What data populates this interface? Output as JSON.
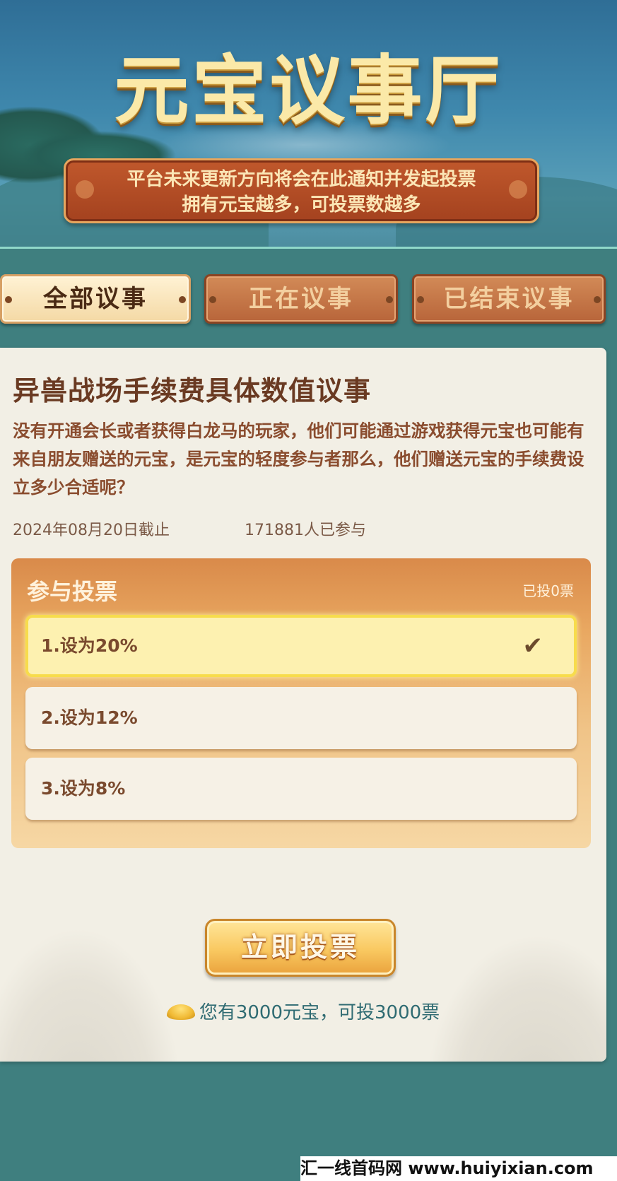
{
  "header": {
    "title": "元宝议事厅",
    "banner_line1": "平台未来更新方向将会在此通知并发起投票",
    "banner_line2": "拥有元宝越多，可投票数越多"
  },
  "tabs": [
    {
      "label": "全部议事",
      "active": true
    },
    {
      "label": "正在议事",
      "active": false
    },
    {
      "label": "已结束议事",
      "active": false
    }
  ],
  "issue": {
    "title": "异兽战场手续费具体数值议事",
    "description": "没有开通会长或者获得白龙马的玩家，他们可能通过游戏获得元宝也可能有来自朋友赠送的元宝，是元宝的轻度参与者那么，他们赠送元宝的手续费设立多少合适呢？",
    "deadline": "2024年08月20日截止",
    "participants": "171881人已参与"
  },
  "vote": {
    "heading": "参与投票",
    "cast": "已投0票",
    "options": [
      {
        "label": "1.设为20%",
        "selected": true
      },
      {
        "label": "2.设为12%",
        "selected": false
      },
      {
        "label": "3.设为8%",
        "selected": false
      }
    ],
    "submit_label": "立即投票",
    "balance": "您有3000元宝，可投3000票"
  },
  "watermark": "汇一线首码网 www.huiyixian.com",
  "colors": {
    "background": "#3f7f7f",
    "card": "#f2efe5",
    "title_gold": "#fbe9a8",
    "banner_red": "#a4421f",
    "selected_option": "#fdf1b0",
    "accent_orange": "#e9a861"
  }
}
